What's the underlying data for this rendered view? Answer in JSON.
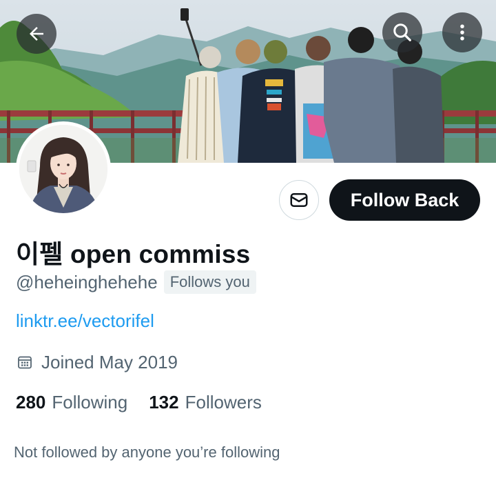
{
  "header": {
    "back_icon": "arrow-left-icon",
    "search_icon": "search-icon",
    "more_icon": "more-vertical-icon"
  },
  "actions": {
    "message_icon": "envelope-icon",
    "follow_label": "Follow Back"
  },
  "profile": {
    "display_name": "이펠 open commiss",
    "handle": "@heheinghehehe",
    "follows_you": "Follows you",
    "link": "linktr.ee/vectorifel",
    "joined": "Joined May 2019",
    "following_count": "280",
    "following_label": "Following",
    "followers_count": "132",
    "followers_label": "Followers",
    "not_followed": "Not followed by anyone you’re following"
  },
  "colors": {
    "accent_link": "#1d9bf0",
    "primary_text": "#0f1419",
    "secondary_text": "#536471",
    "follow_button": "#0f1419"
  }
}
